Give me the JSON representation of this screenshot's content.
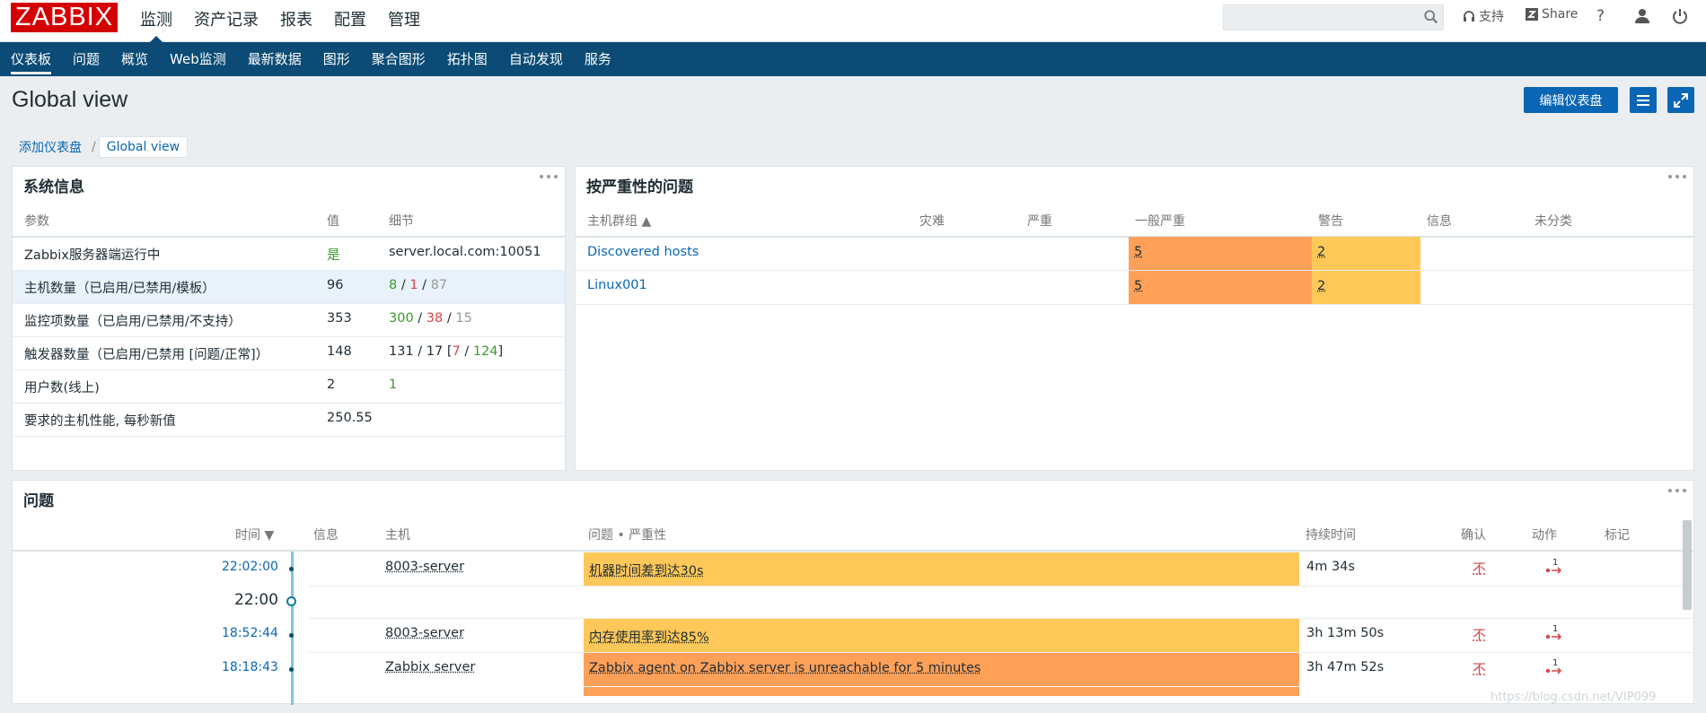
{
  "logo": "ZABBIX",
  "main_menu": [
    "监测",
    "资产记录",
    "报表",
    "配置",
    "管理"
  ],
  "top_links": {
    "support": "支持",
    "share": "Share",
    "help": "?"
  },
  "sub_menu": [
    "仪表板",
    "问题",
    "概览",
    "Web监测",
    "最新数据",
    "图形",
    "聚合图形",
    "拓扑图",
    "自动发现",
    "服务"
  ],
  "page_title": "Global view",
  "edit_button": "编辑仪表盘",
  "breadcrumb": {
    "parent": "添加仪表盘",
    "sep": "/",
    "current": "Global view"
  },
  "system_info": {
    "title": "系统信息",
    "headers": [
      "参数",
      "值",
      "细节"
    ],
    "rows": [
      {
        "param": "Zabbix服务器端运行中",
        "value": "是",
        "detail": "server.local.com:10051"
      },
      {
        "param": "主机数量（已启用/已禁用/模板）",
        "value": "96",
        "d1": "8",
        "s1": " / ",
        "d2": "1",
        "s2": " / ",
        "d3": "87"
      },
      {
        "param": "监控项数量（已启用/已禁用/不支持）",
        "value": "353",
        "d1": "300",
        "s1": " / ",
        "d2": "38",
        "s2": " / ",
        "d3": "15"
      },
      {
        "param": "触发器数量（已启用/已禁用 [问题/正常]）",
        "value": "148",
        "d0": "131 / 17 [",
        "d1": "7",
        "s1": " / ",
        "d2": "124",
        "s2": "]"
      },
      {
        "param": "用户数(线上)",
        "value": "2",
        "detail": "1"
      },
      {
        "param": "要求的主机性能, 每秒新值",
        "value": "250.55"
      }
    ]
  },
  "severity": {
    "title": "按严重性的问题",
    "headers": [
      "主机群组 ▲",
      "灾难",
      "严重",
      "一般严重",
      "警告",
      "信息",
      "未分类"
    ],
    "rows": [
      {
        "group": "Discovered hosts",
        "average": "5",
        "warning": "2"
      },
      {
        "group": "Linux001",
        "average": "5",
        "warning": "2"
      }
    ]
  },
  "problems": {
    "title": "问题",
    "headers": [
      "时间 ▼",
      "信息",
      "主机",
      "问题 • 严重性",
      "持续时间",
      "确认",
      "动作",
      "标记"
    ],
    "rows": [
      {
        "time": "22:02:00",
        "host": "8003-server",
        "problem": "机器时间差到达30s",
        "duration": "4m 34s",
        "ack": "不",
        "actions": "1",
        "color": "#ffc859"
      },
      {
        "hour": "22:00"
      },
      {
        "time": "18:52:44",
        "host": "8003-server",
        "problem": "内存使用率到达85%",
        "duration": "3h 13m 50s",
        "ack": "不",
        "actions": "1",
        "color": "#ffc859"
      },
      {
        "time": "18:18:43",
        "host": "Zabbix server",
        "problem": "Zabbix agent on Zabbix server is unreachable for 5 minutes",
        "duration": "3h 47m 52s",
        "ack": "不",
        "actions": "1",
        "color": "#ffa059"
      }
    ]
  },
  "watermark": "https://blog.csdn.net/VIP099"
}
